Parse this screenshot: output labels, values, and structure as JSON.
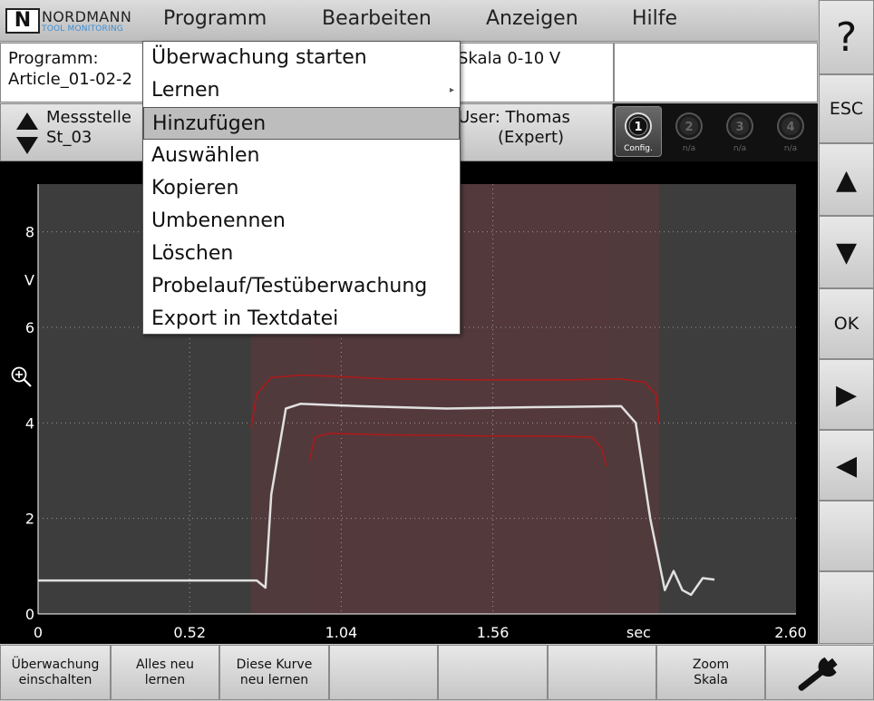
{
  "logo": {
    "mark": "N",
    "name": "NORDMANN",
    "subtitle": "TOOL MONITORING"
  },
  "menu": [
    "Programm",
    "Bearbeiten",
    "Anzeigen",
    "Hilfe"
  ],
  "info": {
    "program_label": "Programm:",
    "program_value": "Article_01-02-2",
    "scale": "Skala 0-10 V",
    "measuring_label": "Messstelle",
    "measuring_value": "St_03",
    "user_line1": "User: Thomas",
    "user_line2": "(Expert)"
  },
  "channels": [
    {
      "number": "1",
      "label": "Config.",
      "active": true
    },
    {
      "number": "2",
      "label": "n/a",
      "active": false
    },
    {
      "number": "3",
      "label": "n/a",
      "active": false
    },
    {
      "number": "4",
      "label": "n/a",
      "active": false
    }
  ],
  "side_buttons": [
    "?",
    "ESC",
    "▲",
    "▼",
    "OK",
    "▶",
    "◀",
    "",
    ""
  ],
  "dropdown": {
    "items": [
      {
        "label": "Überwachung starten",
        "submenu": false
      },
      {
        "label": "Lernen",
        "submenu": true
      },
      {
        "label": "Hinzufügen",
        "submenu": false,
        "selected": true
      },
      {
        "label": "Auswählen",
        "submenu": false
      },
      {
        "label": "Kopieren",
        "submenu": false
      },
      {
        "label": "Umbenennen",
        "submenu": false
      },
      {
        "label": "Löschen",
        "submenu": false
      },
      {
        "label": "Probelauf/Testüberwachung",
        "submenu": false
      },
      {
        "label": "Export in Textdatei",
        "submenu": false
      }
    ]
  },
  "bottom_buttons": [
    "Überwachung\neinschalten",
    "Alles neu\nlernen",
    "Diese Kurve\nneu lernen",
    "",
    "",
    "",
    "Zoom\nSkala",
    ""
  ],
  "colors": {
    "plot_bg": "#3d3d3d",
    "band": "#533a3c",
    "envelope": "#b01818",
    "signal": "#e0e0e0"
  },
  "chart_data": {
    "type": "line",
    "ylabel": "V",
    "xunit": "sec",
    "xlim": [
      0,
      2.6
    ],
    "ylim": [
      0,
      9
    ],
    "xticks": [
      "0",
      "0.52",
      "1.04",
      "1.56",
      "2.60"
    ],
    "yticks": [
      "0",
      "2",
      "4",
      "6",
      "8"
    ],
    "grid": true,
    "bands": [
      {
        "x": [
          0.73,
          2.13
        ],
        "y": [
          0,
          9
        ]
      },
      {
        "x": [
          0.93,
          1.95
        ],
        "y": [
          0,
          9
        ]
      }
    ],
    "series": [
      {
        "role": "signal",
        "x": [
          0,
          0.2,
          0.4,
          0.6,
          0.75,
          0.78,
          0.8,
          0.85,
          0.9,
          1.1,
          1.4,
          1.7,
          2.0,
          2.05,
          2.1,
          2.15,
          2.18,
          2.21,
          2.24,
          2.28,
          2.32
        ],
        "y": [
          0.7,
          0.7,
          0.7,
          0.7,
          0.7,
          0.55,
          2.5,
          4.3,
          4.4,
          4.35,
          4.3,
          4.33,
          4.35,
          4.0,
          2.0,
          0.5,
          0.9,
          0.5,
          0.4,
          0.75,
          0.72
        ]
      },
      {
        "role": "upper-envelope",
        "x": [
          0.73,
          0.75,
          0.8,
          0.9,
          1.0,
          1.2,
          1.5,
          1.8,
          2.0,
          2.08,
          2.12,
          2.13
        ],
        "y": [
          3.9,
          4.6,
          4.95,
          5.0,
          4.98,
          4.92,
          4.9,
          4.9,
          4.92,
          4.85,
          4.6,
          4.0
        ]
      },
      {
        "role": "lower-envelope",
        "x": [
          0.93,
          0.95,
          1.0,
          1.2,
          1.5,
          1.8,
          1.9,
          1.93,
          1.95
        ],
        "y": [
          3.2,
          3.7,
          3.78,
          3.75,
          3.73,
          3.72,
          3.7,
          3.5,
          3.1
        ]
      }
    ]
  }
}
